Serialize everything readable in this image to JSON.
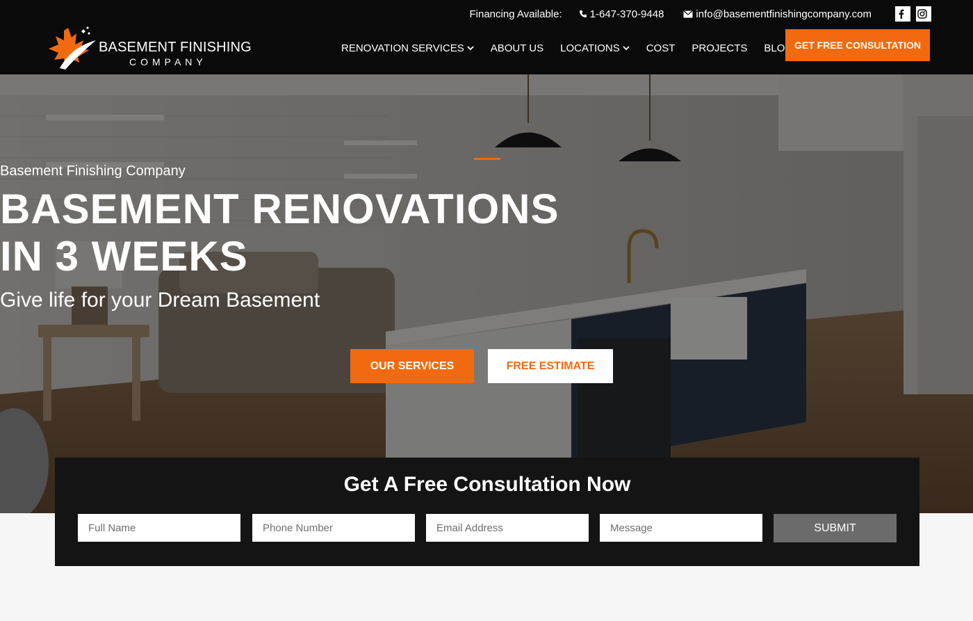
{
  "brand": {
    "name_line1": "BASEMENT FINISHING",
    "name_line2": "COMPANY",
    "accent_color": "#f26a10"
  },
  "topbar": {
    "financing": "Financing Available:",
    "phone": "1-647-370-9448",
    "email": "info@basementfinishingcompany.com",
    "icons": [
      "phone-icon",
      "envelope-icon",
      "facebook-icon",
      "instagram-icon"
    ]
  },
  "nav": {
    "items": [
      {
        "label": "RENOVATION SERVICES",
        "has_dropdown": true
      },
      {
        "label": "ABOUT US",
        "has_dropdown": false
      },
      {
        "label": "LOCATIONS",
        "has_dropdown": true
      },
      {
        "label": "COST",
        "has_dropdown": false
      },
      {
        "label": "PROJECTS",
        "has_dropdown": false
      },
      {
        "label": "BLOG",
        "has_dropdown": false
      }
    ],
    "cta_label": "GET FREE CONSULTATION"
  },
  "hero": {
    "eyebrow": "Basement Finishing Company",
    "title_line1": "BASEMENT RENOVATIONS",
    "title_line2": "IN 3 WEEKS",
    "subtitle": "Give life for your Dream Basement",
    "primary_button": "OUR SERVICES",
    "secondary_button": "FREE ESTIMATE"
  },
  "consultation_form": {
    "title": "Get A Free Consultation Now",
    "fields": {
      "name_placeholder": "Full Name",
      "phone_placeholder": "Phone Number",
      "email_placeholder": "Email Address",
      "message_placeholder": "Message"
    },
    "submit_label": "SUBMIT"
  }
}
